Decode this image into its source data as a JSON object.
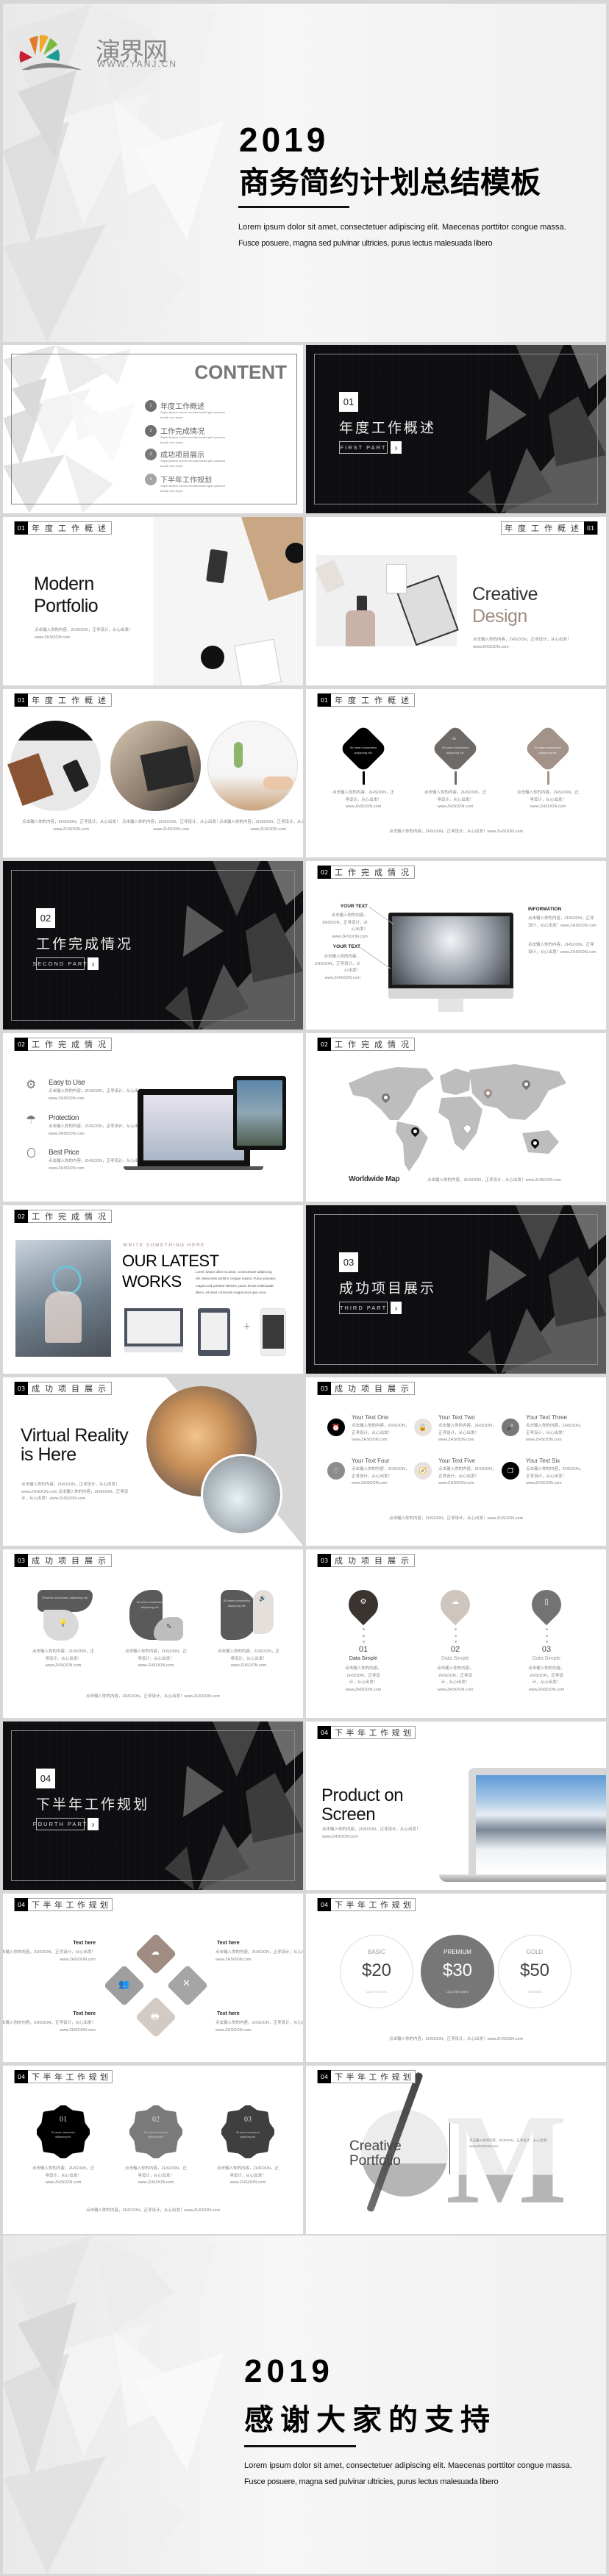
{
  "cover": {
    "logo_name": "演界网",
    "logo_url": "WWW.YANJ.CN",
    "year": "2019",
    "title": "商务简约计划总结模板",
    "desc_line1": "Lorem ipsum dolor sit amet, consectetuer adipiscing elit. Maecenas porttitor congue massa.",
    "desc_line2": "Fusce posuere, magna sed pulvinar ultricies, purus lectus malesuada libero"
  },
  "common": {
    "fill": "点击输入你的内容，ZHSOON，正寻设计，从心出发！",
    "url": "www.ZHSOON.com",
    "fill_full": "点击输入你的内容，ZHSOON，正寻设计，从心出发！www.ZHSOON.com",
    "shape_text": "Sit amet consectetur adipiscing elit."
  },
  "colors": {
    "dark": "#0e0d10",
    "brown": "#a08b80",
    "light_brown": "#d4cac4",
    "gray": "#737373"
  },
  "contents": {
    "title": "CONTENT",
    "items": [
      {
        "num": "1",
        "title": "年度工作概述",
        "desc1": "Sapis dipsem volorio vendian badel ignit quantum",
        "desc2": "tamab vum exper"
      },
      {
        "num": "2",
        "title": "工作完成情况",
        "desc1": "Sapis dipsem volorio vendian badel ignit quantum",
        "desc2": "tamab vum exper"
      },
      {
        "num": "3",
        "title": "成功项目展示",
        "desc1": "Sapis dipsem volorio vendian badel ignit quantum",
        "desc2": "tamab vum exper"
      },
      {
        "num": "4",
        "title": "下半年工作规划",
        "desc1": "Sapis dipsem volorio vendian badel ignit quantum",
        "desc2": "tamab vum exper"
      }
    ]
  },
  "sections": [
    {
      "num": "01",
      "title": "年度工作概述",
      "part": "FIRST PART",
      "arrow": "›"
    },
    {
      "num": "02",
      "title": "工作完成情况",
      "part": "SECOND PART",
      "arrow": "›"
    },
    {
      "num": "03",
      "title": "成功项目展示",
      "part": "THIRD PART",
      "arrow": "›"
    },
    {
      "num": "04",
      "title": "下半年工作规划",
      "part": "FOURTH PART",
      "arrow": "›"
    }
  ],
  "portfolio": {
    "line1": "Modern",
    "line2": "Portfolio"
  },
  "creative": {
    "line1": "Creative",
    "line2": "Design"
  },
  "monitor": {
    "left_titles": [
      "YOUR TEXT",
      "YOUR TEXT"
    ],
    "right_title": "INFORMATION"
  },
  "features": [
    {
      "title": "Easy to Use",
      "icon": "gear-icon"
    },
    {
      "title": "Protection",
      "icon": "umbrella-icon"
    },
    {
      "title": "Best Price",
      "icon": "lightbulb-icon"
    }
  ],
  "map": {
    "title": "Worldwide Map"
  },
  "works": {
    "kicker": "WRITE SOMETHING HERE",
    "line1": "OUR LATEST",
    "line2": "WORKS",
    "para": [
      "Lorem ipsum dolor sit amet, consectetuer adipiscing",
      "elit. Maecenas porttitor congue massa. Fusce posuere,",
      "magna sed pulvinar ultricies, purus lectus malesuada",
      "libero, sit amet commodo magna eros quis urna."
    ],
    "plus": "+"
  },
  "vr": {
    "line1": "Virtual Reality",
    "line2": "is Here"
  },
  "six": [
    {
      "title": "Your Text One",
      "icon": "alarm-clock-icon",
      "color": "#000000"
    },
    {
      "title": "Your Text Two",
      "icon": "lock-icon",
      "color": "#e8e2df"
    },
    {
      "title": "Your Text Three",
      "icon": "microphone-icon",
      "color": "#787878"
    },
    {
      "title": "Your Text Four",
      "icon": "heart-icon",
      "color": "#8c8c8c"
    },
    {
      "title": "Your Text Five",
      "icon": "compass-icon",
      "color": "#e8e2df"
    },
    {
      "title": "Your Text Six",
      "icon": "copy-icon",
      "color": "#000000"
    }
  ],
  "pins": [
    {
      "num": "01",
      "label": "Data Simple",
      "icon": "gear-icon",
      "color": "#3a3330"
    },
    {
      "num": "02",
      "label": "Data Simple",
      "icon": "cloud-icon",
      "color": "#cfc5bf"
    },
    {
      "num": "03",
      "label": "Data Simple",
      "icon": "book-icon",
      "color": "#737373"
    }
  ],
  "product": {
    "line1": "Product on",
    "line2": "Screen"
  },
  "diamond_labels": [
    "Text here",
    "Text here",
    "Text here",
    "Text here"
  ],
  "pricing": [
    {
      "tier": "BASIC",
      "price": "$20",
      "note": "Up to 5 Users"
    },
    {
      "tier": "PREMIUM",
      "price": "$30",
      "note": "Up to 50 Users"
    },
    {
      "tier": "GOLD",
      "price": "$50",
      "note": "Unlimited"
    }
  ],
  "badges": [
    "01",
    "02",
    "03"
  ],
  "portfolio2": {
    "line1": "Creative",
    "line2": "Portfolio",
    "letter": "M"
  },
  "closing": {
    "year": "2019",
    "title": "感谢大家的支持",
    "desc_line1": "Lorem ipsum dolor sit amet, consectetuer adipiscing elit. Maecenas porttitor congue massa.",
    "desc_line2": "Fusce posuere, magna sed pulvinar ultricies, purus lectus malesuada libero"
  }
}
